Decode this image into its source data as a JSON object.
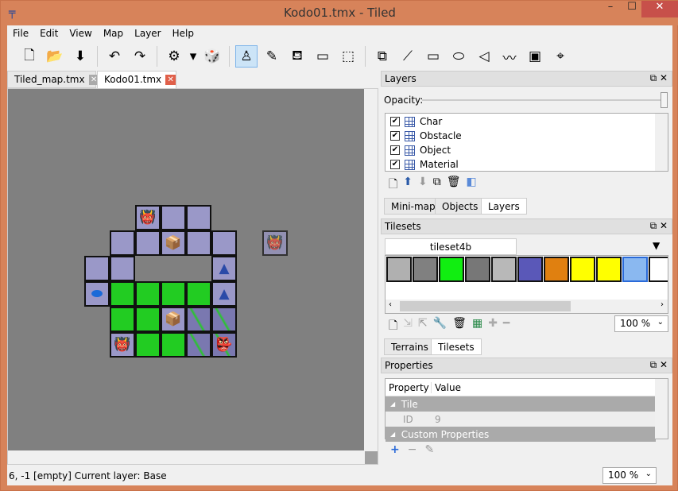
{
  "window": {
    "title": "Kodo01.tmx - Tiled",
    "minimize": "–",
    "maximize": "☐",
    "close": "✕"
  },
  "menu": [
    "File",
    "Edit",
    "View",
    "Map",
    "Layer",
    "Help"
  ],
  "toolbar": {
    "icons": [
      "new-file-icon",
      "open-file-icon",
      "save-icon",
      "undo-icon",
      "redo-icon",
      "command-gear-icon",
      "dropdown-arrow-icon",
      "random-dice-icon",
      "stamp-brush-icon",
      "terrain-brush-icon",
      "bucket-fill-icon",
      "eraser-icon",
      "rectangle-select-icon",
      "select-objects-icon",
      "edit-polygons-icon",
      "insert-rectangle-icon",
      "insert-ellipse-icon",
      "insert-polygon-icon",
      "insert-polyline-icon",
      "insert-tile-icon",
      "crop-icon"
    ],
    "glyphs": [
      "🗋",
      "📂",
      "⬇",
      "↶",
      "↷",
      "⚙",
      "▾",
      "🎲",
      "♙",
      "✎",
      "⛾",
      "▭",
      "⬚",
      "⧉",
      "⟋",
      "▭",
      "⬭",
      "◁",
      "〰",
      "▣",
      "⌖"
    ],
    "active": "stamp-brush-icon"
  },
  "tabs": [
    {
      "label": "Tiled_map.tmx",
      "active": false
    },
    {
      "label": "Kodo01.tmx",
      "active": true
    }
  ],
  "map": {
    "tiles": [
      [
        "",
        "",
        "char",
        "stone",
        "stone",
        ""
      ],
      [
        "",
        "stone",
        "stone",
        "box",
        "stone",
        "stone"
      ],
      [
        "stone",
        "stone",
        "",
        "",
        "",
        "cone"
      ],
      [
        "disc",
        "grass",
        "grass",
        "grass",
        "grass",
        "cone"
      ],
      [
        "",
        "grass",
        "grass",
        "box",
        "vine",
        "vine"
      ],
      [
        "",
        "char",
        "grass",
        "grass",
        "vine",
        "greenchar"
      ]
    ],
    "cursor_tile": "char"
  },
  "status": {
    "text": "6, -1 [empty]  Current layer: Base",
    "zoom": "100 %"
  },
  "layers": {
    "title": "Layers",
    "opacity_label": "Opacity:",
    "opacity": 1.0,
    "items": [
      {
        "name": "Char",
        "visible": true
      },
      {
        "name": "Obstacle",
        "visible": true
      },
      {
        "name": "Object",
        "visible": true
      },
      {
        "name": "Material",
        "visible": true
      }
    ],
    "tabs": [
      "Mini-map",
      "Objects",
      "Layers"
    ],
    "active_tab": "Layers"
  },
  "tilesets": {
    "title": "Tilesets",
    "tab": "tileset4b",
    "tiles": [
      {
        "bg": "#b0b0b0"
      },
      {
        "bg": "#808080"
      },
      {
        "bg": "#11ee11"
      },
      {
        "bg": "#777777"
      },
      {
        "bg": "#b8b8b8"
      },
      {
        "bg": "#5a58b8"
      },
      {
        "bg": "#e08010"
      },
      {
        "bg": "#ffff00"
      },
      {
        "bg": "#ffff00"
      },
      {
        "bg": "#8ab8f0"
      },
      {
        "bg": "#ffffff"
      }
    ],
    "zoom": "100 %",
    "tabs": [
      "Terrains",
      "Tilesets"
    ],
    "active_tab": "Tilesets"
  },
  "properties": {
    "title": "Properties",
    "headers": [
      "Property",
      "Value"
    ],
    "rows": [
      {
        "type": "group",
        "name": "Tile"
      },
      {
        "type": "prop",
        "name": "ID",
        "value": "9"
      },
      {
        "type": "group",
        "name": "Custom Properties"
      }
    ],
    "buttons": [
      "+",
      "−",
      "✎"
    ]
  }
}
